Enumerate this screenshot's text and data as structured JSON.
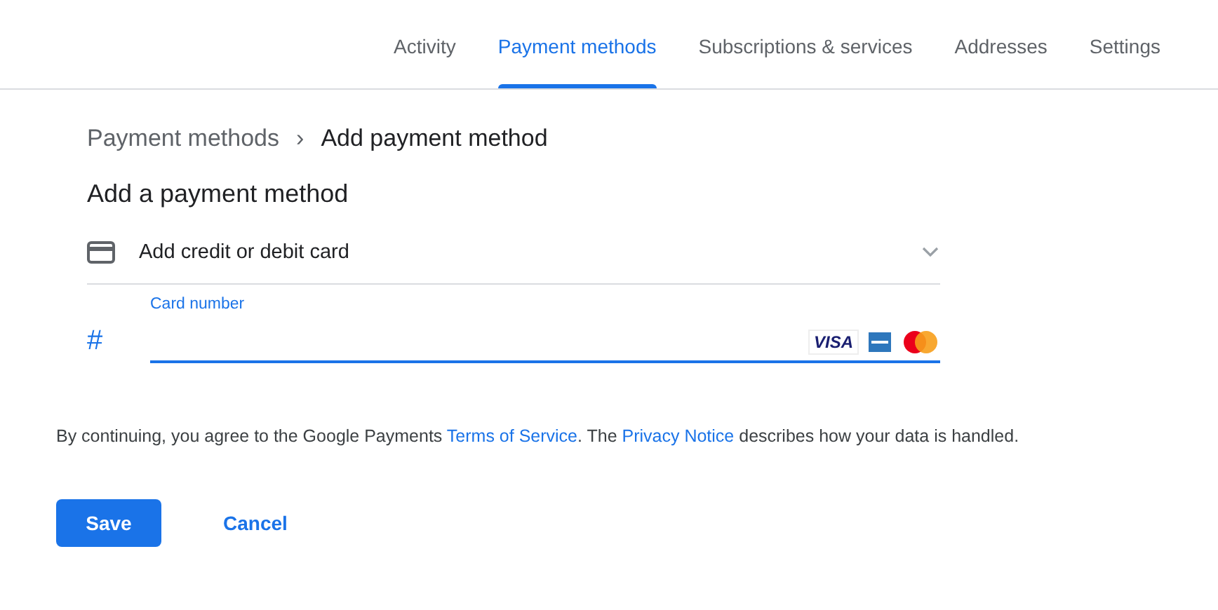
{
  "tabs": [
    {
      "label": "Activity",
      "selected": false
    },
    {
      "label": "Payment methods",
      "selected": true
    },
    {
      "label": "Subscriptions & services",
      "selected": false
    },
    {
      "label": "Addresses",
      "selected": false
    },
    {
      "label": "Settings",
      "selected": false
    }
  ],
  "breadcrumb": {
    "parent": "Payment methods",
    "separator": "›",
    "current": "Add payment method"
  },
  "heading": "Add a payment method",
  "method_row": {
    "label": "Add credit or debit card",
    "expanded": true
  },
  "card_field": {
    "icon": "#",
    "label": "Card number",
    "brand_text": "VISA"
  },
  "consent": [
    {
      "kind": "text",
      "text": "By continuing, you agree to the Google Payments "
    },
    {
      "kind": "link",
      "text": "Terms of Service"
    },
    {
      "kind": "text",
      "text": ". The "
    },
    {
      "kind": "link",
      "text": "Privacy Notice"
    },
    {
      "kind": "text",
      "text": " describes how your data is handled."
    }
  ],
  "buttons": [
    {
      "label": "Save",
      "kind": "primary"
    },
    {
      "label": "Cancel",
      "kind": "text"
    }
  ]
}
